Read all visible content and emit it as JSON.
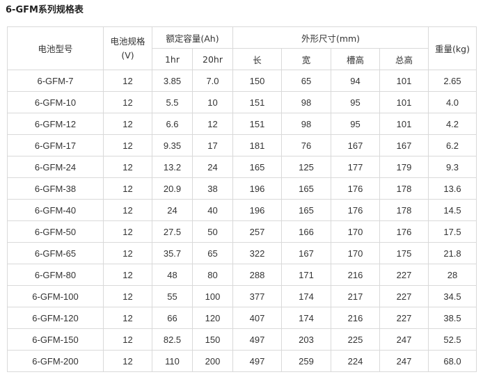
{
  "title": "6-GFM系列规格表",
  "headers": {
    "model": "电池型号",
    "voltage_line1": "电池规格",
    "voltage_line2": "(V)",
    "capacity": "额定容量(Ah)",
    "capacity_1hr": "1hr",
    "capacity_20hr": "20hr",
    "dimensions": "外形尺寸(mm)",
    "length": "长",
    "width": "宽",
    "groove_height": "槽高",
    "total_height": "总高",
    "weight": "重量(kg)"
  },
  "rows": [
    {
      "model": "6-GFM-7",
      "voltage": "12",
      "c1": "3.85",
      "c20": "7.0",
      "length": "150",
      "width": "65",
      "groove": "94",
      "total": "101",
      "weight": "2.65"
    },
    {
      "model": "6-GFM-10",
      "voltage": "12",
      "c1": "5.5",
      "c20": "10",
      "length": "151",
      "width": "98",
      "groove": "95",
      "total": "101",
      "weight": "4.0"
    },
    {
      "model": "6-GFM-12",
      "voltage": "12",
      "c1": "6.6",
      "c20": "12",
      "length": "151",
      "width": "98",
      "groove": "95",
      "total": "101",
      "weight": "4.2"
    },
    {
      "model": "6-GFM-17",
      "voltage": "12",
      "c1": "9.35",
      "c20": "17",
      "length": "181",
      "width": "76",
      "groove": "167",
      "total": "167",
      "weight": "6.2"
    },
    {
      "model": "6-GFM-24",
      "voltage": "12",
      "c1": "13.2",
      "c20": "24",
      "length": "165",
      "width": "125",
      "groove": "177",
      "total": "179",
      "weight": "9.3"
    },
    {
      "model": "6-GFM-38",
      "voltage": "12",
      "c1": "20.9",
      "c20": "38",
      "length": "196",
      "width": "165",
      "groove": "176",
      "total": "178",
      "weight": "13.6"
    },
    {
      "model": "6-GFM-40",
      "voltage": "12",
      "c1": "24",
      "c20": "40",
      "length": "196",
      "width": "165",
      "groove": "176",
      "total": "178",
      "weight": "14.5"
    },
    {
      "model": "6-GFM-50",
      "voltage": "12",
      "c1": "27.5",
      "c20": "50",
      "length": "257",
      "width": "166",
      "groove": "170",
      "total": "176",
      "weight": "17.5"
    },
    {
      "model": "6-GFM-65",
      "voltage": "12",
      "c1": "35.7",
      "c20": "65",
      "length": "322",
      "width": "167",
      "groove": "170",
      "total": "175",
      "weight": "21.8"
    },
    {
      "model": "6-GFM-80",
      "voltage": "12",
      "c1": "48",
      "c20": "80",
      "length": "288",
      "width": "171",
      "groove": "216",
      "total": "227",
      "weight": "28"
    },
    {
      "model": "6-GFM-100",
      "voltage": "12",
      "c1": "55",
      "c20": "100",
      "length": "377",
      "width": "174",
      "groove": "217",
      "total": "227",
      "weight": "34.5"
    },
    {
      "model": "6-GFM-120",
      "voltage": "12",
      "c1": "66",
      "c20": "120",
      "length": "407",
      "width": "174",
      "groove": "216",
      "total": "227",
      "weight": "38.5"
    },
    {
      "model": "6-GFM-150",
      "voltage": "12",
      "c1": "82.5",
      "c20": "150",
      "length": "497",
      "width": "203",
      "groove": "225",
      "total": "247",
      "weight": "52.5"
    },
    {
      "model": "6-GFM-200",
      "voltage": "12",
      "c1": "110",
      "c20": "200",
      "length": "497",
      "width": "259",
      "groove": "224",
      "total": "247",
      "weight": "68.0"
    }
  ]
}
